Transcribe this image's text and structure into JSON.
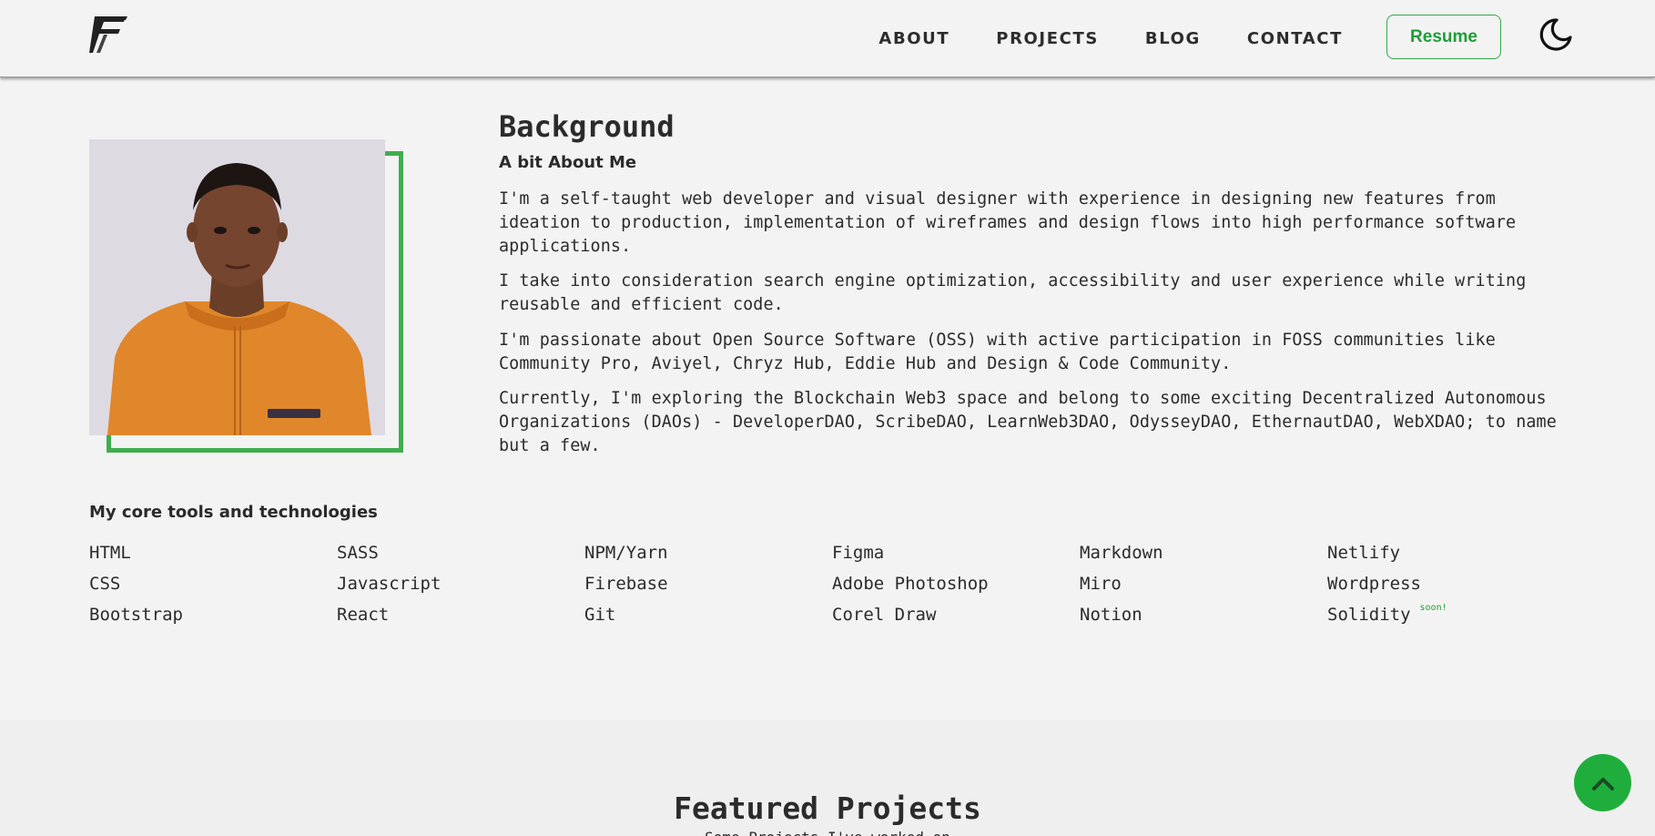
{
  "nav": {
    "items": [
      "ABOUT",
      "PROJECTS",
      "BLOG",
      "CONTACT"
    ],
    "resume_label": "Resume"
  },
  "about": {
    "title": "Background",
    "subtitle": "A bit About Me",
    "paragraphs": [
      "I'm a self-taught web developer and visual designer with experience in designing new features from ideation to production, implementation of wireframes and design flows into high performance software applications.",
      "I take into consideration search engine optimization, accessibility and user experience while writing reusable and efficient code.",
      "I'm passionate about Open Source Software (OSS) with active participation in FOSS communities like Community Pro, Aviyel, Chryz Hub, Eddie Hub and Design & Code Community.",
      "Currently, I'm exploring the Blockchain Web3 space and belong to some exciting Decentralized Autonomous Organizations (DAOs) - DeveloperDAO, ScribeDAO, LearnWeb3DAO, OdysseyDAO, EthernautDAO, WebXDAO; to name but a few."
    ]
  },
  "tools": {
    "title": "My core tools and technologies",
    "columns": [
      [
        "HTML",
        "CSS",
        "Bootstrap"
      ],
      [
        "SASS",
        "Javascript",
        "React"
      ],
      [
        "NPM/Yarn",
        "Firebase",
        "Git"
      ],
      [
        "Figma",
        "Adobe Photoshop",
        "Corel Draw"
      ],
      [
        "Markdown",
        "Miro",
        "Notion"
      ],
      [
        "Netlify",
        "Wordpress",
        "Solidity"
      ]
    ],
    "soon_label": "soon!"
  },
  "featured": {
    "title": "Featured Projects",
    "subtitle": "Some Projects I've worked on"
  },
  "colors": {
    "accent": "#1fae3c",
    "frame": "#3fae4d",
    "background": "#f3f3f3"
  },
  "icons": {
    "logo": "ff-logo-icon",
    "theme": "moon-icon",
    "scroll": "chevron-up-icon"
  }
}
